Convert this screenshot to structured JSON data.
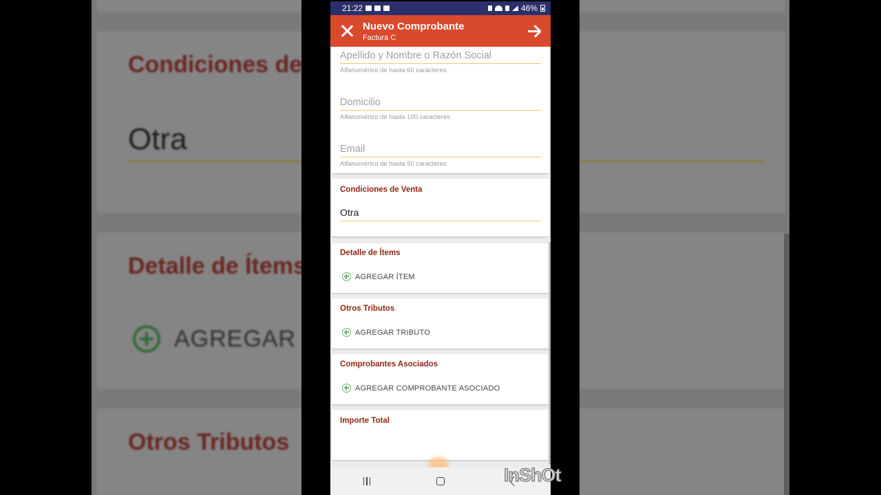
{
  "status_bar": {
    "time": "21:22",
    "battery": "46%"
  },
  "app_bar": {
    "title": "Nuevo Comprobante",
    "subtitle": "Factura C"
  },
  "client_fields": [
    {
      "placeholder": "Apellido y Nombre o Razón Social",
      "help": "Alfanumérico de hasta 60 caracteres"
    },
    {
      "placeholder": "Domicilio",
      "help": "Alfanumérico de hasta 100 caracteres"
    },
    {
      "placeholder": "Email",
      "help": "Alfanumérico de hasta 50 caracteres"
    }
  ],
  "sale_conditions": {
    "title": "Condiciones de Venta",
    "value": "Otra"
  },
  "items": {
    "title": "Detalle de Ítems",
    "add_label": "AGREGAR ÍTEM"
  },
  "other_taxes": {
    "title": "Otros Tributos",
    "add_label": "AGREGAR TRIBUTO"
  },
  "associated": {
    "title": "Comprobantes Asociados",
    "add_label": "AGREGAR COMPROBANTE ASOCIADO"
  },
  "total": {
    "title": "Importe Total"
  },
  "background": {
    "title_conditions": "Condiciones de",
    "value": "Otra",
    "title_items": "Detalle de Ítems",
    "add_label": "AGREGAR Í",
    "title_taxes": "Otros Tributos"
  },
  "watermark": "InShOt",
  "colors": {
    "accent": "#d84a2b",
    "status_bar": "#2b2f6b",
    "section_title": "#8f2616",
    "add_icon": "#66bb6a",
    "underline": "#f2c46b"
  }
}
